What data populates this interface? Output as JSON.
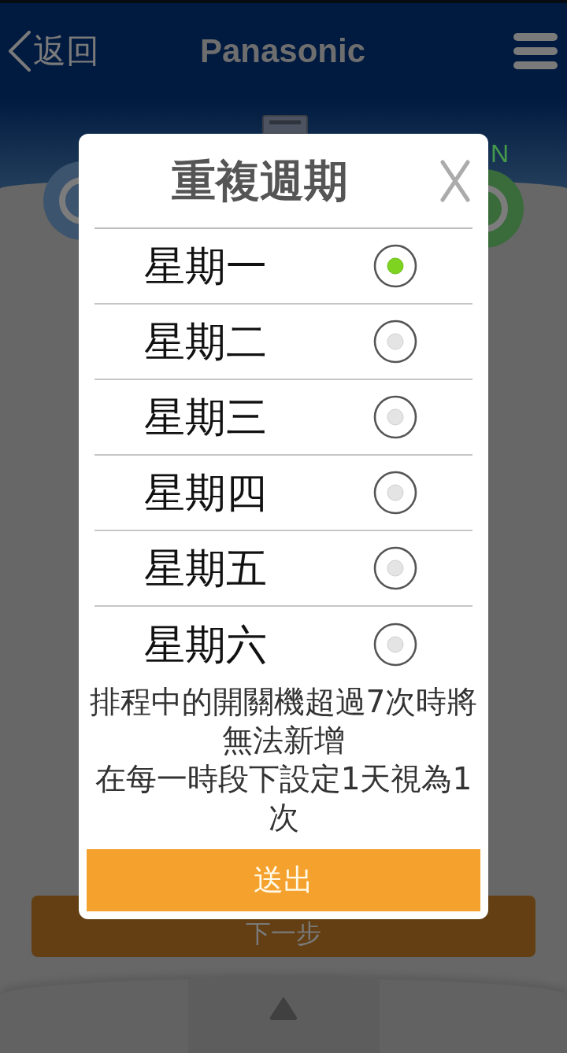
{
  "header": {
    "back_label": "返回",
    "title": "Panasonic"
  },
  "power": {
    "label": "N"
  },
  "next_button": {
    "label": "下一步"
  },
  "dialog": {
    "title": "重複週期",
    "options": [
      {
        "label": "星期一",
        "selected": true
      },
      {
        "label": "星期二",
        "selected": false
      },
      {
        "label": "星期三",
        "selected": false
      },
      {
        "label": "星期四",
        "selected": false
      },
      {
        "label": "星期五",
        "selected": false
      },
      {
        "label": "星期六",
        "selected": false
      }
    ],
    "notice": [
      "排程中的開關機超過7次時將無法新增",
      "在每一時段下設定1天視為1次"
    ],
    "submit_label": "送出"
  }
}
